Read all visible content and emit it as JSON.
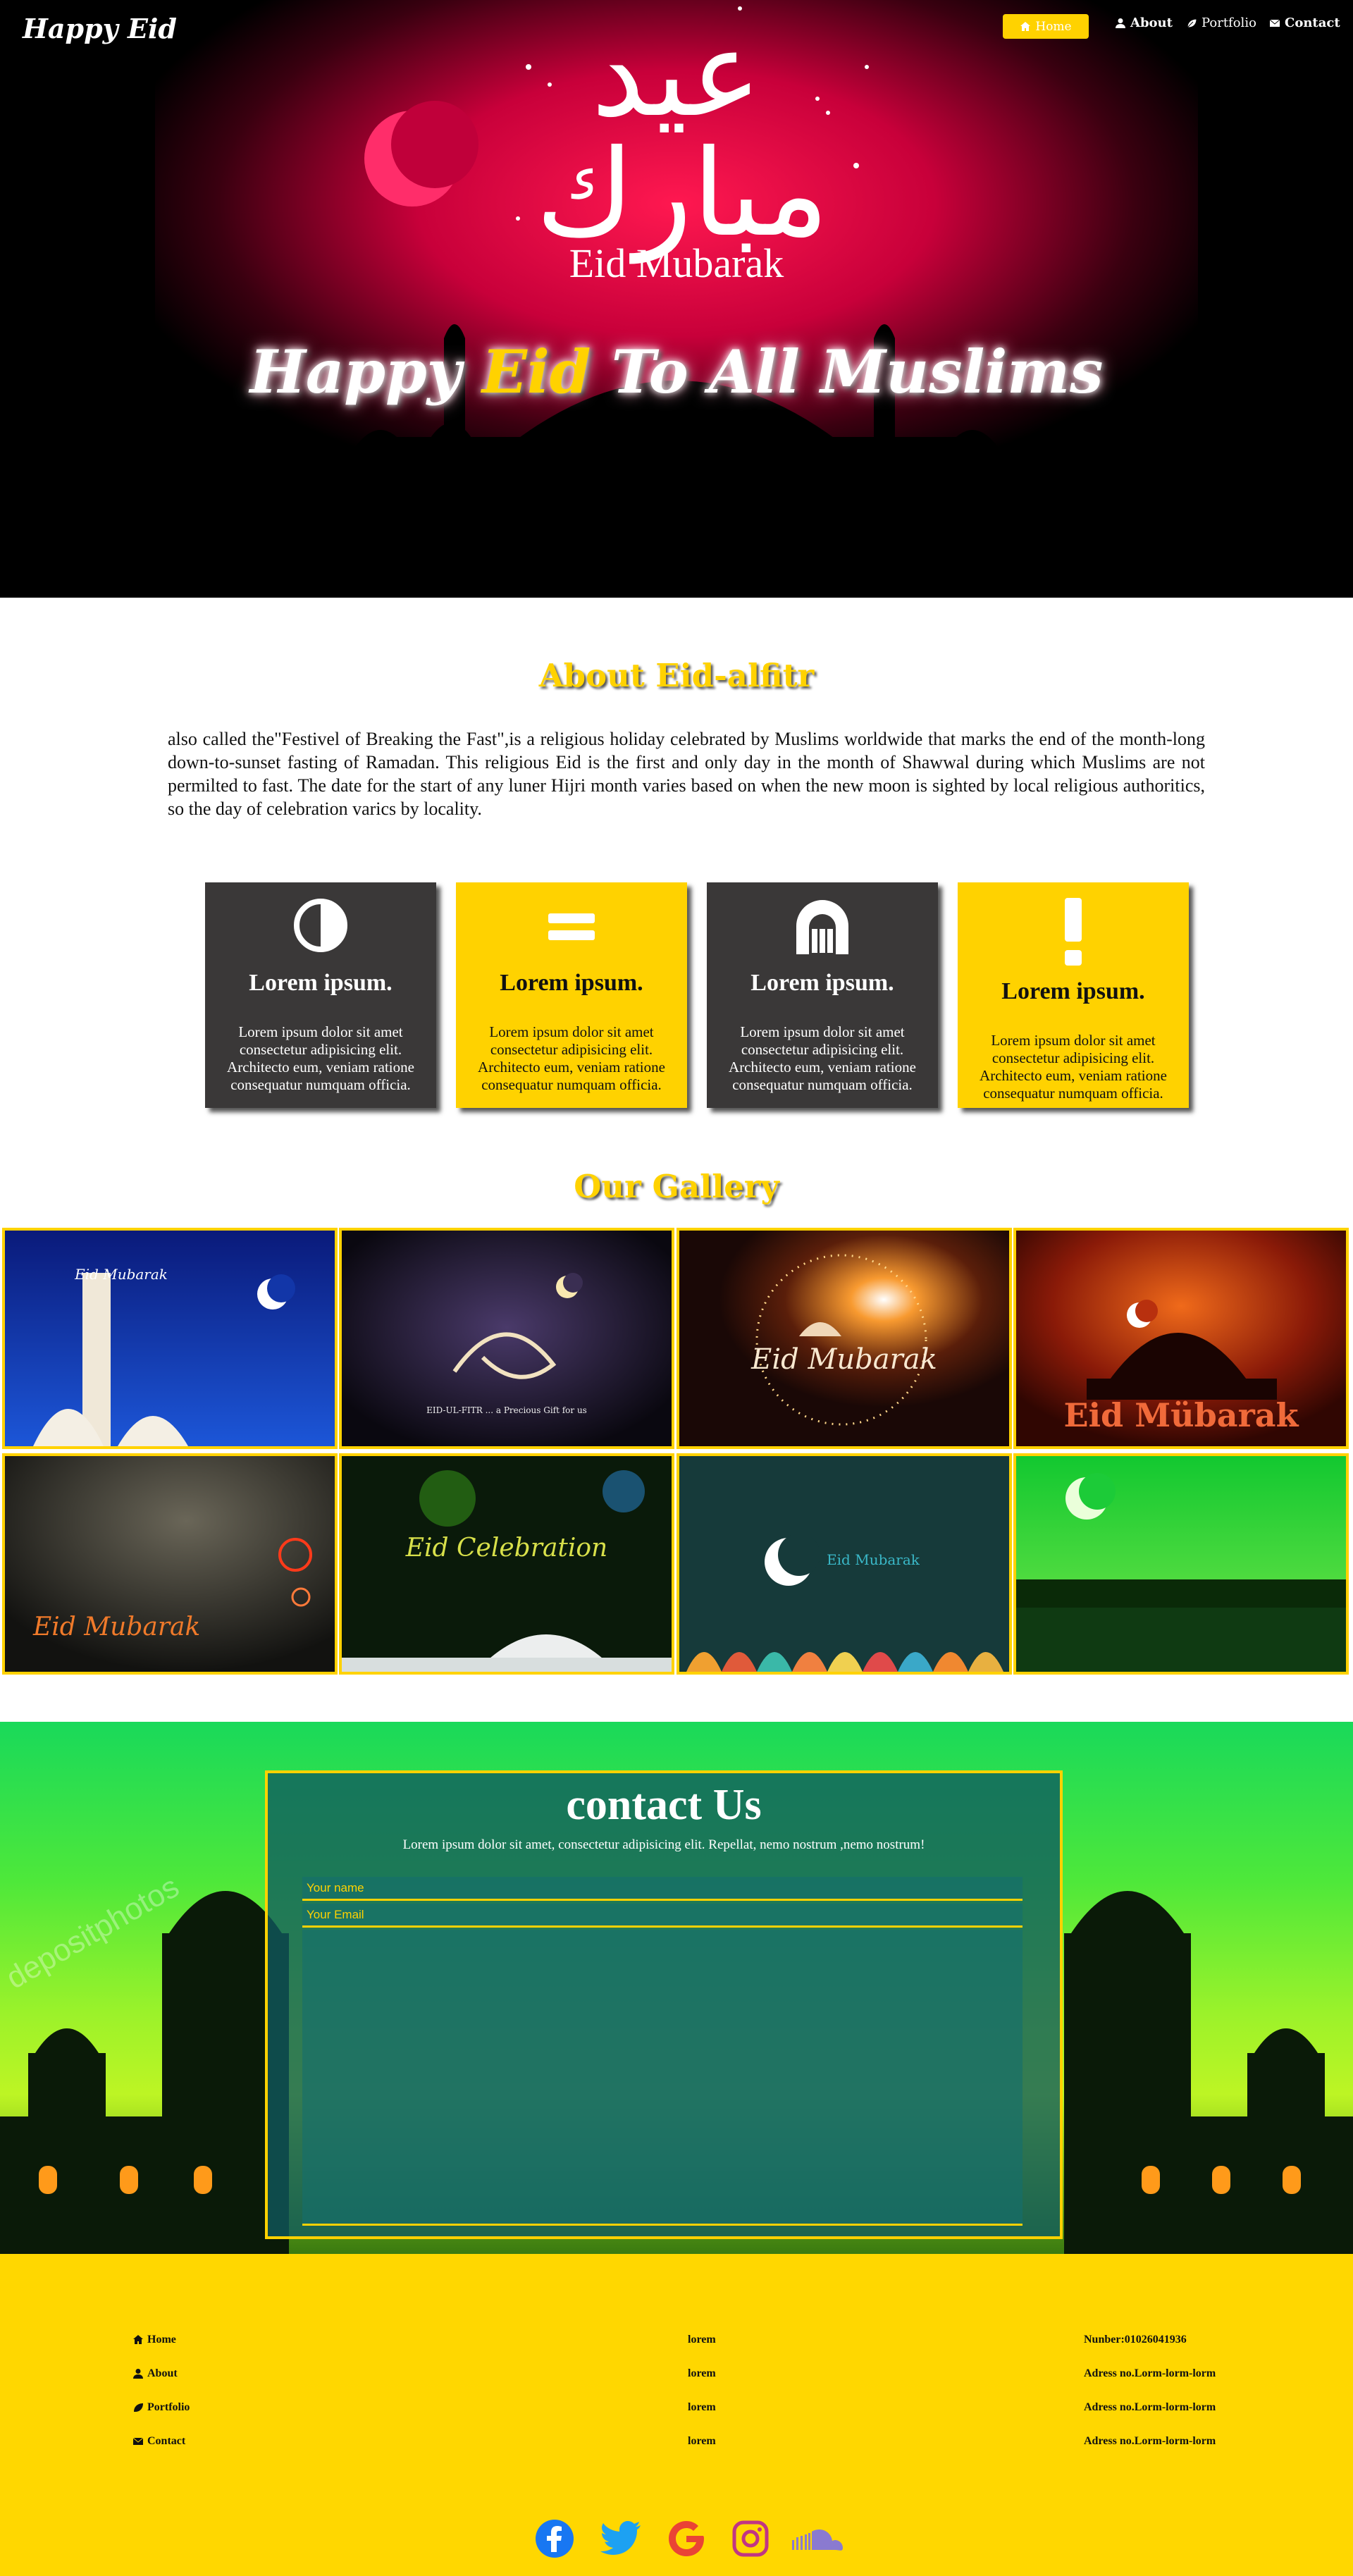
{
  "nav": {
    "brand": "Happy Eid",
    "items": [
      {
        "label": "Home",
        "icon": "home-icon",
        "active": true
      },
      {
        "label": "About",
        "icon": "user-icon"
      },
      {
        "label": "Portfolio",
        "icon": "leaf-icon"
      },
      {
        "label": "Contact",
        "icon": "envelope-icon"
      }
    ]
  },
  "hero": {
    "arabic_calligraphy": "عيد مبارك",
    "eid_mubarak": "Eid Mubarak",
    "title_part1": "Happy ",
    "title_highlight": "Eid",
    "title_part2": " To All Muslims"
  },
  "about": {
    "title": "About Eid-alfitr",
    "text": "also called the\"Festivel of Breaking the Fast\",is a religious holiday celebrated by Muslims worldwide that marks the end of the month-long down-to-sunset fasting of Ramadan. This religious Eid is the first and only day in the month of Shawwal during which Muslims are not permilted to fast. The date for the start of any luner Hijri month varies based on when the new moon is sighted by local religious authoritics, so the day of celebration varics by locality."
  },
  "cards": [
    {
      "title": "Lorem ipsum.",
      "text": "Lorem ipsum dolor sit amet consectetur adipisicing elit. Architecto eum, veniam ratione consequatur numquam officia.",
      "icon": "half-circle-icon",
      "theme": "dark"
    },
    {
      "title": "Lorem ipsum.",
      "text": "Lorem ipsum dolor sit amet consectetur adipisicing elit. Architecto eum, veniam ratione consequatur numquam officia.",
      "icon": "equals-icon",
      "theme": "yellow"
    },
    {
      "title": "Lorem ipsum.",
      "text": "Lorem ipsum dolor sit amet consectetur adipisicing elit. Architecto eum, veniam ratione consequatur numquam officia.",
      "icon": "archway-icon",
      "theme": "dark"
    },
    {
      "title": "Lorem ipsum.",
      "text": "Lorem ipsum dolor sit amet consectetur adipisicing elit. Architecto eum, veniam ratione consequatur numquam officia.",
      "icon": "exclamation-icon",
      "theme": "yellow"
    }
  ],
  "gallery": {
    "title": "Our Gallery",
    "images": [
      {
        "caption": "Eid Mubarak"
      },
      {
        "caption": "EID-UL-FITR ... a Precious Gift for us"
      },
      {
        "caption": "Eid Mubarak"
      },
      {
        "caption": "Eid Mübarak"
      },
      {
        "caption": "Eid Mubarak"
      },
      {
        "caption": "Eid Celebration"
      },
      {
        "caption": "Eid Mubarak"
      },
      {
        "caption": ""
      }
    ]
  },
  "contact": {
    "title": "contact Us",
    "subtitle": "Lorem ipsum dolor sit amet, consectetur adipisicing elit. Repellat, nemo nostrum ,nemo nostrum!",
    "name_placeholder": "Your name",
    "email_placeholder": "Your Email",
    "watermark": "depositphotos"
  },
  "footer": {
    "links": [
      {
        "label": "Home",
        "icon": "home-icon"
      },
      {
        "label": "About",
        "icon": "user-icon"
      },
      {
        "label": "Portfolio",
        "icon": "leaf-icon"
      },
      {
        "label": "Contact",
        "icon": "envelope-icon"
      }
    ],
    "middle": [
      "lorem",
      "lorem",
      "lorem",
      "lorem"
    ],
    "right": [
      "Nunber:01026041936",
      "Adress no.Lorm-lorm-lorm",
      "Adress no.Lorm-lorm-lorm",
      "Adress no.Lorm-lorm-lorm"
    ],
    "social": [
      {
        "name": "facebook-icon",
        "color": "#1877f2"
      },
      {
        "name": "twitter-icon",
        "color": "#1da1f2"
      },
      {
        "name": "google-icon",
        "color": "#ea4335"
      },
      {
        "name": "instagram-icon",
        "color": "#c13584"
      },
      {
        "name": "soundcloud-icon",
        "color": "#8a7ad0"
      }
    ]
  },
  "colors": {
    "accent": "#ffd200",
    "dark_card": "#3a3838",
    "footer": "#ffd700"
  }
}
